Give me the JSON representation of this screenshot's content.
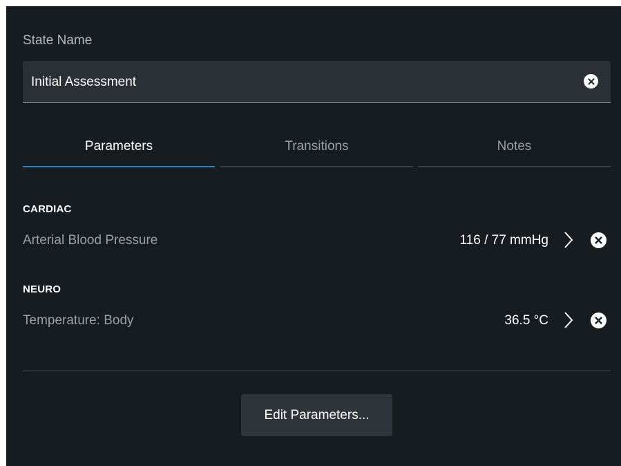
{
  "state_name": {
    "label": "State Name",
    "value": "Initial Assessment",
    "clear_icon": "close-circle-icon"
  },
  "tabs": [
    {
      "label": "Parameters",
      "active": true
    },
    {
      "label": "Transitions",
      "active": false
    },
    {
      "label": "Notes",
      "active": false
    }
  ],
  "groups": [
    {
      "title": "CARDIAC",
      "params": [
        {
          "name": "Arterial Blood Pressure",
          "value": "116 / 77 mmHg"
        }
      ]
    },
    {
      "title": "NEURO",
      "params": [
        {
          "name": "Temperature: Body",
          "value": "36.5 °C"
        }
      ]
    }
  ],
  "edit_button": {
    "label": "Edit Parameters..."
  },
  "colors": {
    "background": "#171c21",
    "field": "#2a3035",
    "accent": "#2b85c5",
    "button": "#2e3439"
  }
}
